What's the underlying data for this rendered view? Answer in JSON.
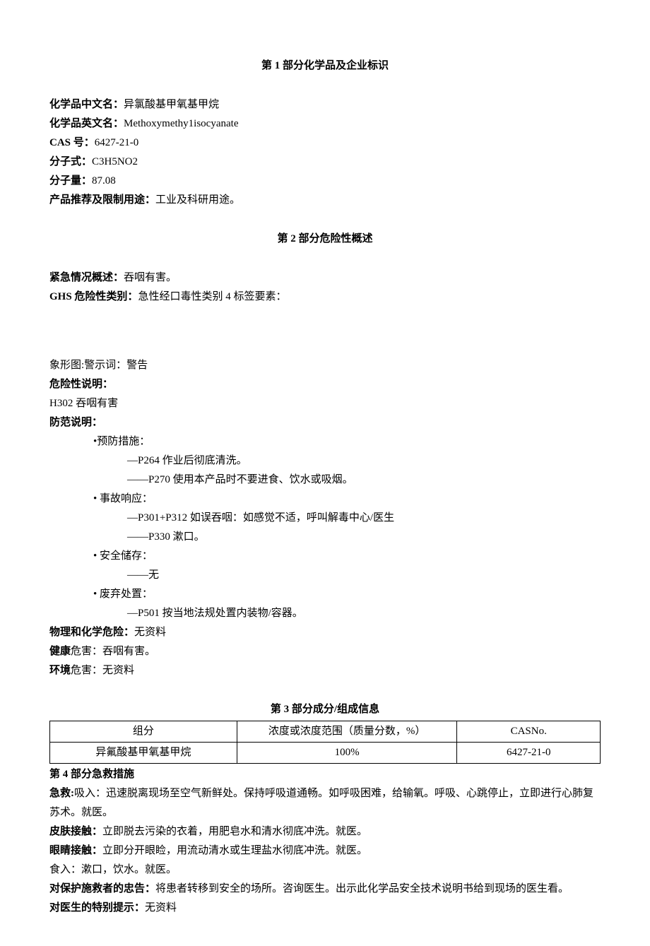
{
  "section1": {
    "title": "第 1 部分化学品及企业标识",
    "cn_label": "化学品中文名：",
    "cn_value": "异氯酸基甲氧基甲烷",
    "en_label": "化学品英文名：",
    "en_value": "Methoxymethy1isocyanate",
    "cas_label": "CAS 号：",
    "cas_value": "6427-21-0",
    "formula_label": "分子式：",
    "formula_value": "C3H5NO2",
    "mw_label": "分子量：",
    "mw_value": "87.08",
    "use_label": "产品推荐及限制用途：",
    "use_value": "工业及科研用途。"
  },
  "section2": {
    "title": "第 2 部分危险性概述",
    "emergency_label": "紧急情况概述：",
    "emergency_value": "吞咽有害。",
    "ghs_label": "GHS 危险性类别：",
    "ghs_value": "急性经口毒性类别 4 标签要素：",
    "pictogram_line": "象形图:警示词：警告",
    "hazard_stmt_label": "危险性说明：",
    "h302": "H302 吞咽有害",
    "precaution_label": "防范说明：",
    "prevent_header": "•预防措施：",
    "p264": "—P264 作业后彻底清洗。",
    "p270": "——P270 使用本产品时不要进食、饮水或吸烟。",
    "accident_header": "• 事故响应：",
    "p301": "—P301+P312 如误吞咽：如感觉不适，呼叫解毒中心/医生",
    "p330": "——P330 漱口。",
    "storage_header": "• 安全储存：",
    "storage_none": "——无",
    "disposal_header": "• 废弃处置：",
    "p501": "—P501 按当地法规处置内装物/容器。",
    "phys_label": "物理和化学危险：",
    "phys_value": "无资料",
    "health_label": "健康",
    "health_mid": "危害：",
    "health_value": "吞咽有害。",
    "env_label": "环境",
    "env_mid": "危害：",
    "env_value": "无资料"
  },
  "section3": {
    "title": "第 3 部分成分/组成信息",
    "th1": "组分",
    "th2": "浓度或浓度范围（质量分数，%）",
    "th3": "CASNo.",
    "r1c1": "异氟酸基甲氧基甲烷",
    "r1c2": "100%",
    "r1c3": "6427-21-0"
  },
  "section4": {
    "title": "第 4 部分急救措施",
    "aid_label": "急救:",
    "inhale": "吸入：迅速脱离现场至空气新鲜处。保持呼吸道通畅。如呼吸困难，给输氧。呼吸、心跳停止，立即进行心肺复苏术。就医。",
    "skin_label": "皮肤接触：",
    "skin_value": "立即脱去污染的衣着，用肥皂水和清水彻底冲洗。就医。",
    "eye_label": "眼睛接触：",
    "eye_value": "立即分开眼睑，用流动清水或生理盐水彻底冲洗。就医。",
    "ingest": "食入：漱口，饮水。就医。",
    "rescuer_label": "对保护施救者的忠告：",
    "rescuer_value": "将患者转移到安全的场所。咨询医生。出示此化学品安全技术说明书给到现场的医生看。",
    "doctor_label": "对医生的特别提示：",
    "doctor_value": "无资料"
  }
}
